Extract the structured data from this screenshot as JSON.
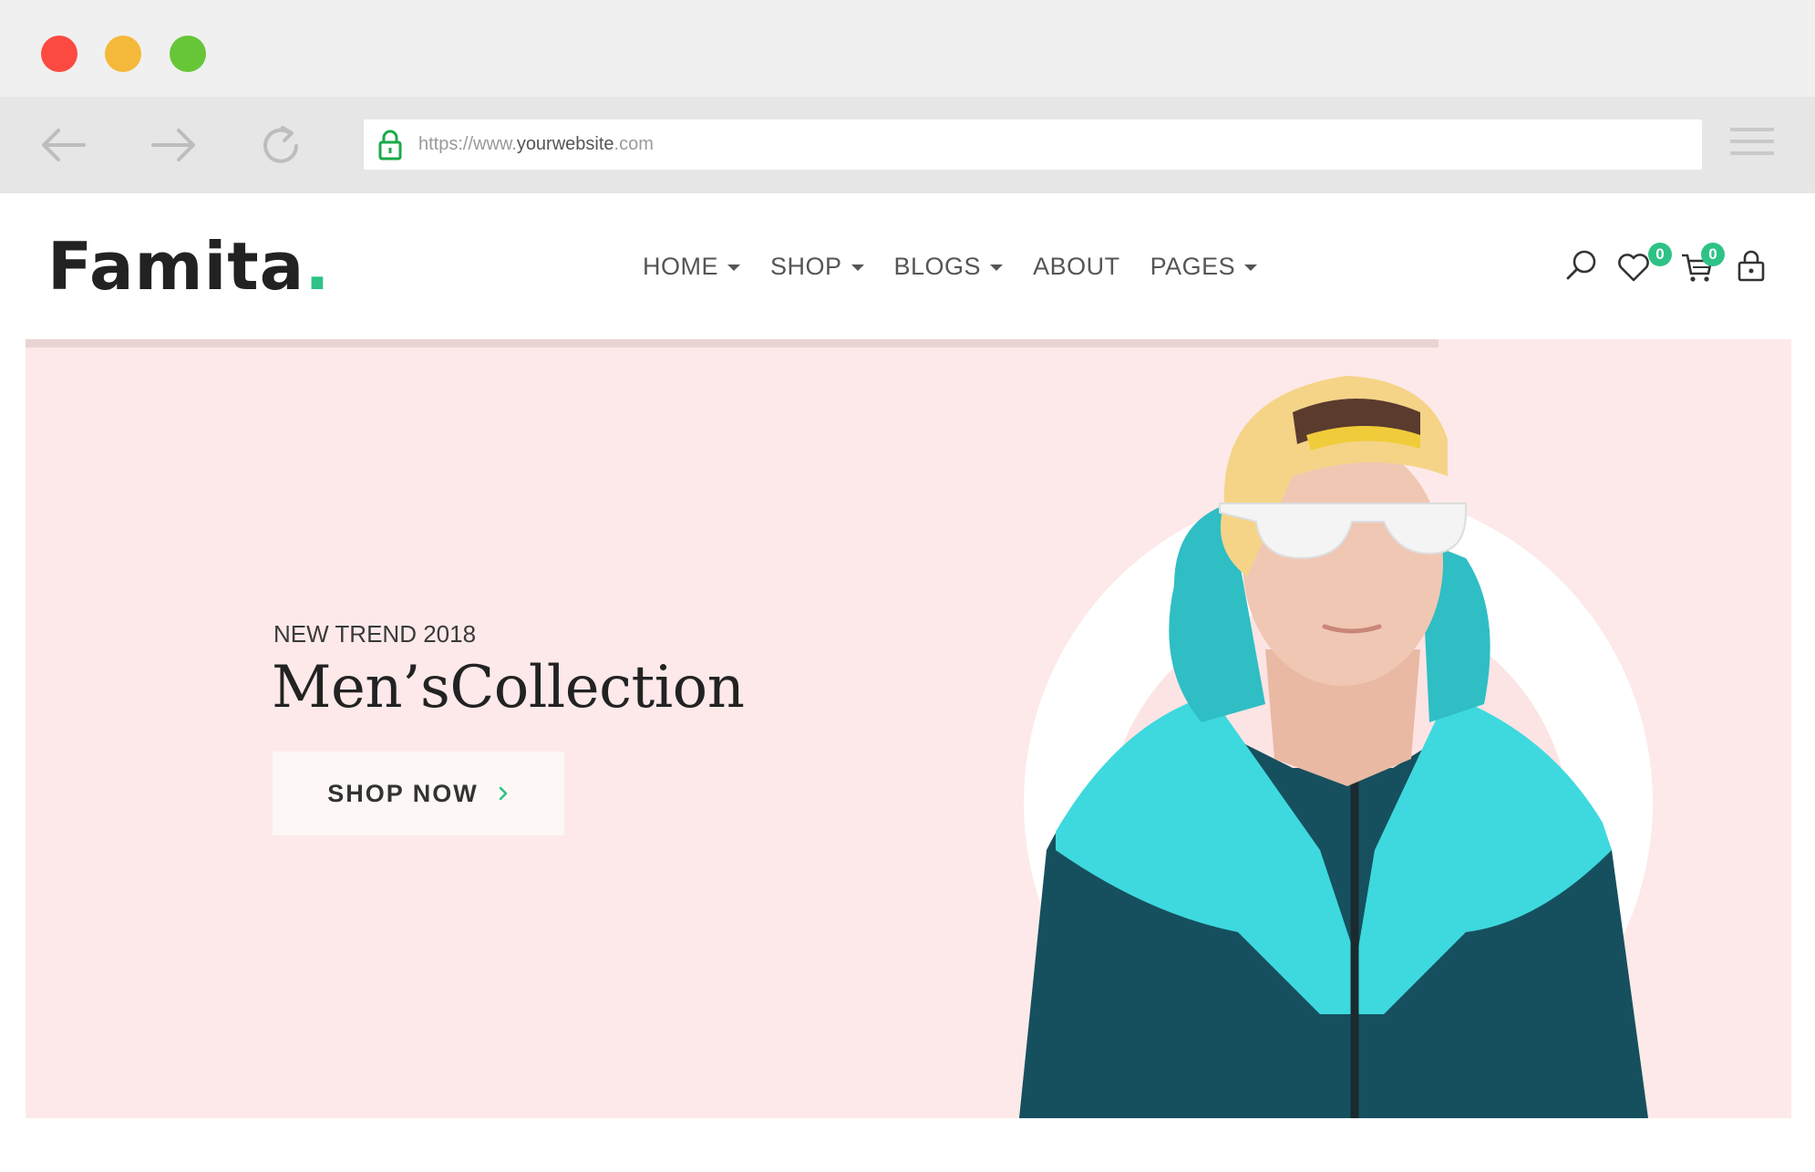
{
  "browser": {
    "url_scheme": "https://www.",
    "url_host": "yourwebsite",
    "url_tld": ".com"
  },
  "site": {
    "logo_text": "Famita",
    "logo_dot": ".",
    "nav": [
      {
        "label": "HOME",
        "dropdown": true
      },
      {
        "label": "SHOP",
        "dropdown": true
      },
      {
        "label": "BLOGS",
        "dropdown": true
      },
      {
        "label": "ABOUT",
        "dropdown": false
      },
      {
        "label": "PAGES",
        "dropdown": true
      }
    ],
    "wishlist_count": "0",
    "cart_count": "0"
  },
  "hero": {
    "subtitle": "NEW TREND 2018",
    "title": "Men’sCollection",
    "cta_label": "SHOP NOW",
    "slide_progress": 0.8
  },
  "colors": {
    "accent": "#2ec286",
    "hero_bg": "#fde9e9"
  }
}
